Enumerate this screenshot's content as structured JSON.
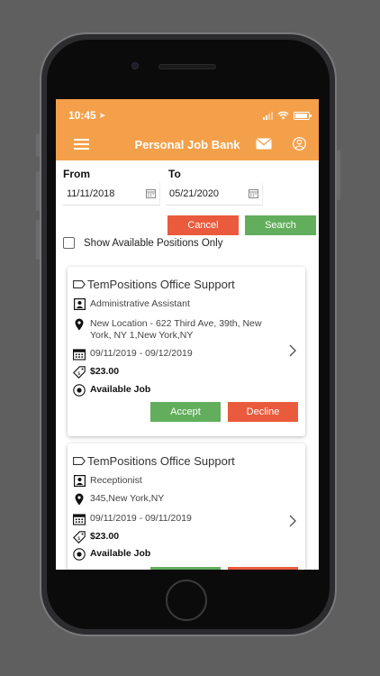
{
  "status_bar": {
    "time": "10:45"
  },
  "header": {
    "title": "Personal Job Bank"
  },
  "filters": {
    "from_label": "From",
    "to_label": "To",
    "from_value": "11/11/2018",
    "to_value": "05/21/2020",
    "cancel_label": "Cancel",
    "search_label": "Search",
    "available_only_label": "Show Available Positions Only"
  },
  "jobs": [
    {
      "company": "TemPositions Office Support",
      "position": "Administrative Assistant",
      "location_line1": "New Location - 622 Third Ave, 39th, New",
      "location_line2": "York, NY 1,New York,NY",
      "dates": "09/11/2019 - 09/12/2019",
      "rate": "$23.00",
      "status": "Available Job",
      "accept_label": "Accept",
      "decline_label": "Decline"
    },
    {
      "company": "TemPositions Office Support",
      "position": "Receptionist",
      "location_line1": "345,New York,NY",
      "dates": "09/11/2019 - 09/11/2019",
      "rate": "$23.00",
      "status": "Available Job"
    }
  ],
  "colors": {
    "header": "#f4a04a",
    "cancel": "#ea5a3c",
    "search": "#62ae5c",
    "accept": "#62ae5c",
    "decline": "#ea5a3c"
  }
}
